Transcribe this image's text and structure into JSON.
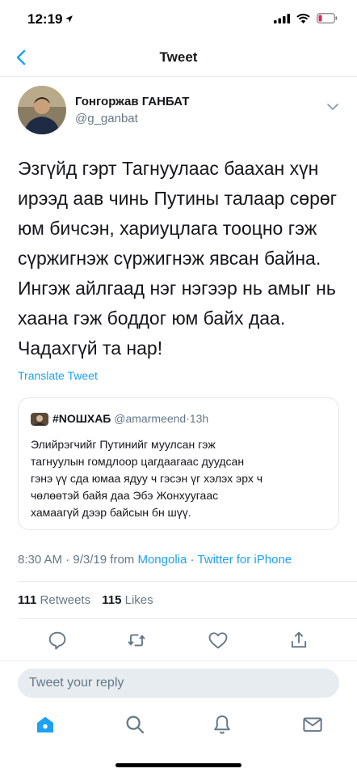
{
  "status": {
    "time": "12:19"
  },
  "nav": {
    "title": "Tweet"
  },
  "tweet": {
    "author_name": "Гонгоржав ГАНБАТ",
    "author_handle": "@g_ganbat",
    "text_lines": [
      "Эзгүйд гэрт Тагнуулаас баахан хүн",
      "ирээд аав чинь Путины талаар сөрөг",
      "юм бичсэн, хариуцлага тооцно гэж",
      "сүржигнэж сүржигнэж явсан байна.",
      "Ингэж айлгаад нэг нэгээр нь амыг нь",
      "хаана гэж боддог юм байх даа.",
      "Чадахгүй та нар!"
    ],
    "translate_label": "Translate Tweet",
    "time": "8:30 AM",
    "date": "9/3/19",
    "from_label": "from",
    "location": "Mongolia",
    "sep": "·",
    "source": "Twitter for iPhone",
    "retweets_count": "111",
    "retweets_label": "Retweets",
    "likes_count": "115",
    "likes_label": "Likes"
  },
  "quote": {
    "name": "#NOШХАБ",
    "handle": "@amarmeend",
    "time": "13h",
    "text_lines": [
      "Элийрэгчийг  Путинийг муулсан гэж",
      "тагнуулын гомдлоор цагдаагаас дуудсан",
      "гэнэ үү  сда юмаа ядуу ч гэсэн үг хэлэх эрх ч",
      "чөлөөтэй  байя даа Эбэ Жонхуугаас",
      "хамаагүй дээр байсын бн шүү."
    ]
  },
  "reply": {
    "placeholder": "Tweet your reply"
  },
  "icons": {
    "back": "chevron-left-icon",
    "more": "chevron-down-icon",
    "reply": "reply-icon",
    "retweet": "retweet-icon",
    "like": "heart-icon",
    "share": "share-icon",
    "home": "home-icon",
    "search": "search-icon",
    "notifications": "bell-icon",
    "messages": "mail-icon"
  },
  "colors": {
    "accent": "#1da1f2",
    "secondary": "#657786",
    "text": "#14171a",
    "divider": "#e6ecf0",
    "battery_low": "#e0245e"
  }
}
